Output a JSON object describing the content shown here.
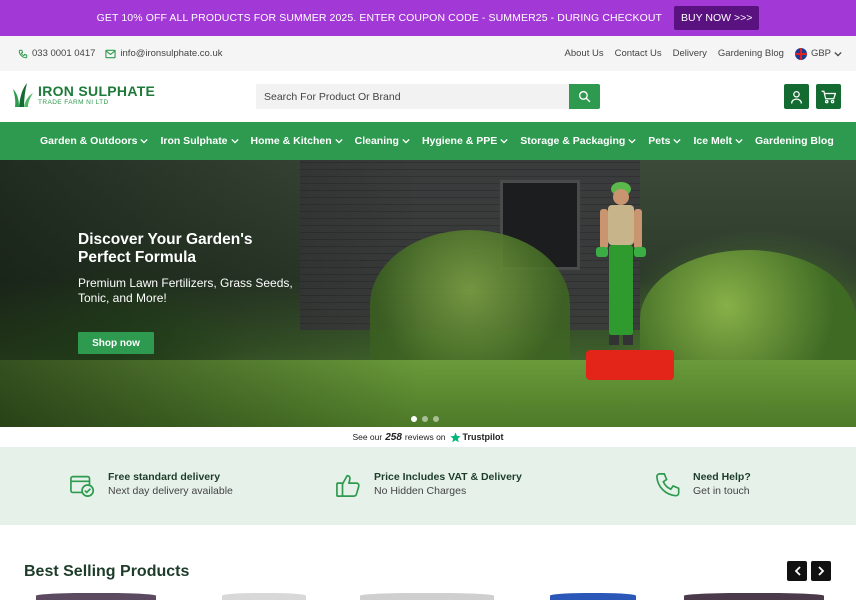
{
  "promo": {
    "text": "GET 10% OFF ALL PRODUCTS FOR SUMMER 2025. ENTER COUPON CODE - SUMMER25 - DURING CHECKOUT",
    "button_label": "BUY NOW >>>"
  },
  "topbar": {
    "phone": "033 0001 0417",
    "email": "info@ironsulphate.co.uk",
    "links": [
      "About Us",
      "Contact Us",
      "Delivery",
      "Gardening Blog"
    ],
    "currency": "GBP"
  },
  "header": {
    "logo_name": "IRON SULPHATE",
    "logo_sub": "TRADE FARM NI LTD",
    "search_placeholder": "Search For Product Or Brand"
  },
  "nav": {
    "items": [
      {
        "label": "Garden & Outdoors",
        "dropdown": true
      },
      {
        "label": "Iron Sulphate",
        "dropdown": true
      },
      {
        "label": "Home & Kitchen",
        "dropdown": true
      },
      {
        "label": "Cleaning",
        "dropdown": true
      },
      {
        "label": "Hygiene & PPE",
        "dropdown": true
      },
      {
        "label": "Storage & Packaging",
        "dropdown": true
      },
      {
        "label": "Pets",
        "dropdown": true
      },
      {
        "label": "Ice Melt",
        "dropdown": true
      },
      {
        "label": "Gardening Blog",
        "dropdown": false
      }
    ]
  },
  "hero": {
    "title": "Discover Your Garden's Perfect Formula",
    "subtitle": "Premium Lawn Fertilizers, Grass Seeds, Tonic, and More!",
    "cta_label": "Shop now",
    "slide_count": 3,
    "active_slide": 0
  },
  "trustpilot": {
    "prefix": "See our",
    "count": "258",
    "suffix": "reviews on",
    "brand": "Trustpilot"
  },
  "features": [
    {
      "icon": "delivery-icon",
      "title": "Free standard delivery",
      "sub": "Next day delivery available"
    },
    {
      "icon": "thumbs-up-icon",
      "title": "Price Includes VAT & Delivery",
      "sub": "No Hidden Charges"
    },
    {
      "icon": "phone-icon",
      "title": "Need Help?",
      "sub": "Get in touch"
    }
  ],
  "best_selling": {
    "title": "Best Selling Products"
  },
  "colors": {
    "promo_bg": "#a238d6",
    "promo_button": "#5a1280",
    "brand_green": "#2e9a4f",
    "dark_green": "#146b32",
    "features_bg": "#e6f1e9"
  }
}
